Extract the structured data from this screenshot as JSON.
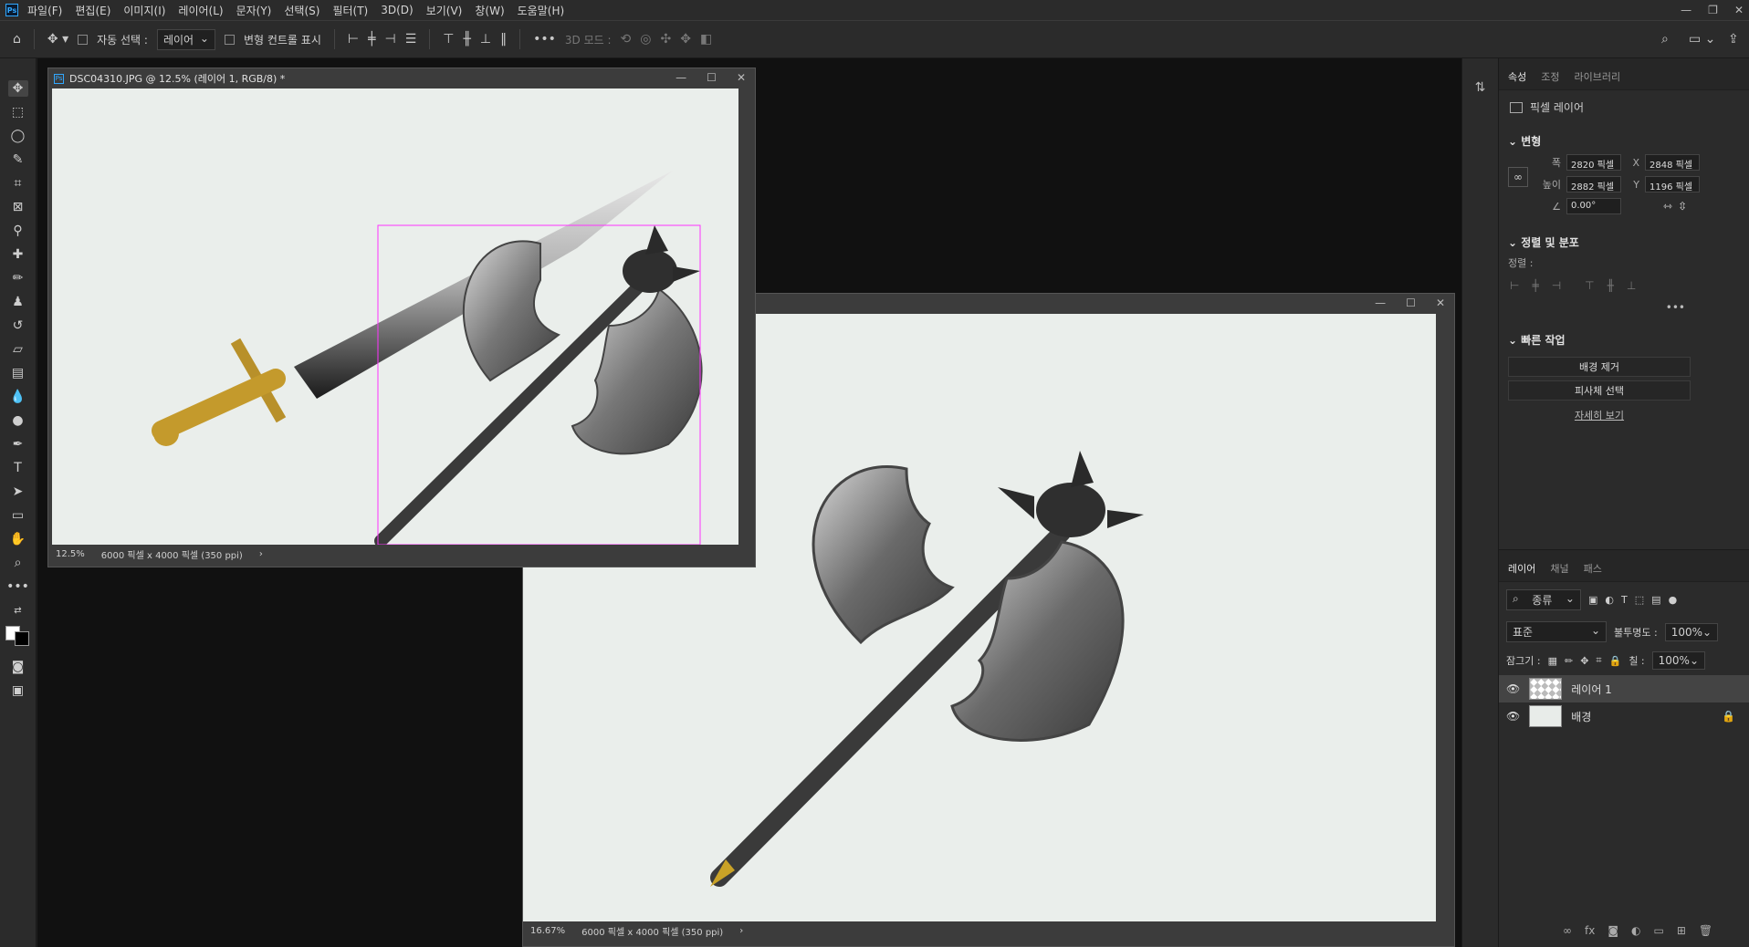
{
  "menubar": {
    "logo": "Ps",
    "items": [
      "파일(F)",
      "편집(E)",
      "이미지(I)",
      "레이어(L)",
      "문자(Y)",
      "선택(S)",
      "필터(T)",
      "3D(D)",
      "보기(V)",
      "창(W)",
      "도움말(H)"
    ]
  },
  "options": {
    "auto_select_label": "자동 선택 :",
    "auto_select_value": "레이어",
    "transform_controls_label": "변형 컨트롤 표시",
    "mode3d_label": "3D 모드 :"
  },
  "doc1": {
    "title": "DSC04310.JPG @ 12.5% (레이어 1, RGB/8) *",
    "zoom": "12.5%",
    "info": "6000 픽셀 x 4000 픽셀 (350 ppi)"
  },
  "doc2": {
    "zoom": "16.67%",
    "info": "6000 픽셀 x 4000 픽셀 (350 ppi)"
  },
  "panel": {
    "tabs": [
      "속성",
      "조정",
      "라이브러리"
    ],
    "layer_type": "픽셀 레이어",
    "transform_header": "변형",
    "width_label": "폭",
    "width_value": "2820 픽셀",
    "height_label": "높이",
    "height_value": "2882 픽셀",
    "x_label": "X",
    "x_value": "2848 픽셀",
    "y_label": "Y",
    "y_value": "1196 픽셀",
    "angle_value": "0.00°",
    "align_header": "정렬 및 분포",
    "align_label": "정렬 :",
    "quick_header": "빠른 작업",
    "remove_bg": "배경 제거",
    "select_subject": "피사체 선택",
    "learn_more": "자세히 보기"
  },
  "layers": {
    "tabs": [
      "레이어",
      "채널",
      "패스"
    ],
    "filter_kind": "종류",
    "blend_mode": "표준",
    "opacity_label": "불투명도 :",
    "opacity_value": "100%",
    "lock_label": "잠그기 :",
    "fill_label": "칠 :",
    "fill_value": "100%",
    "items": [
      {
        "name": "레이어 1"
      },
      {
        "name": "배경"
      }
    ]
  },
  "colors": {
    "foreground": "#ffffff",
    "background": "#000000",
    "selection": "#ff33ff"
  }
}
